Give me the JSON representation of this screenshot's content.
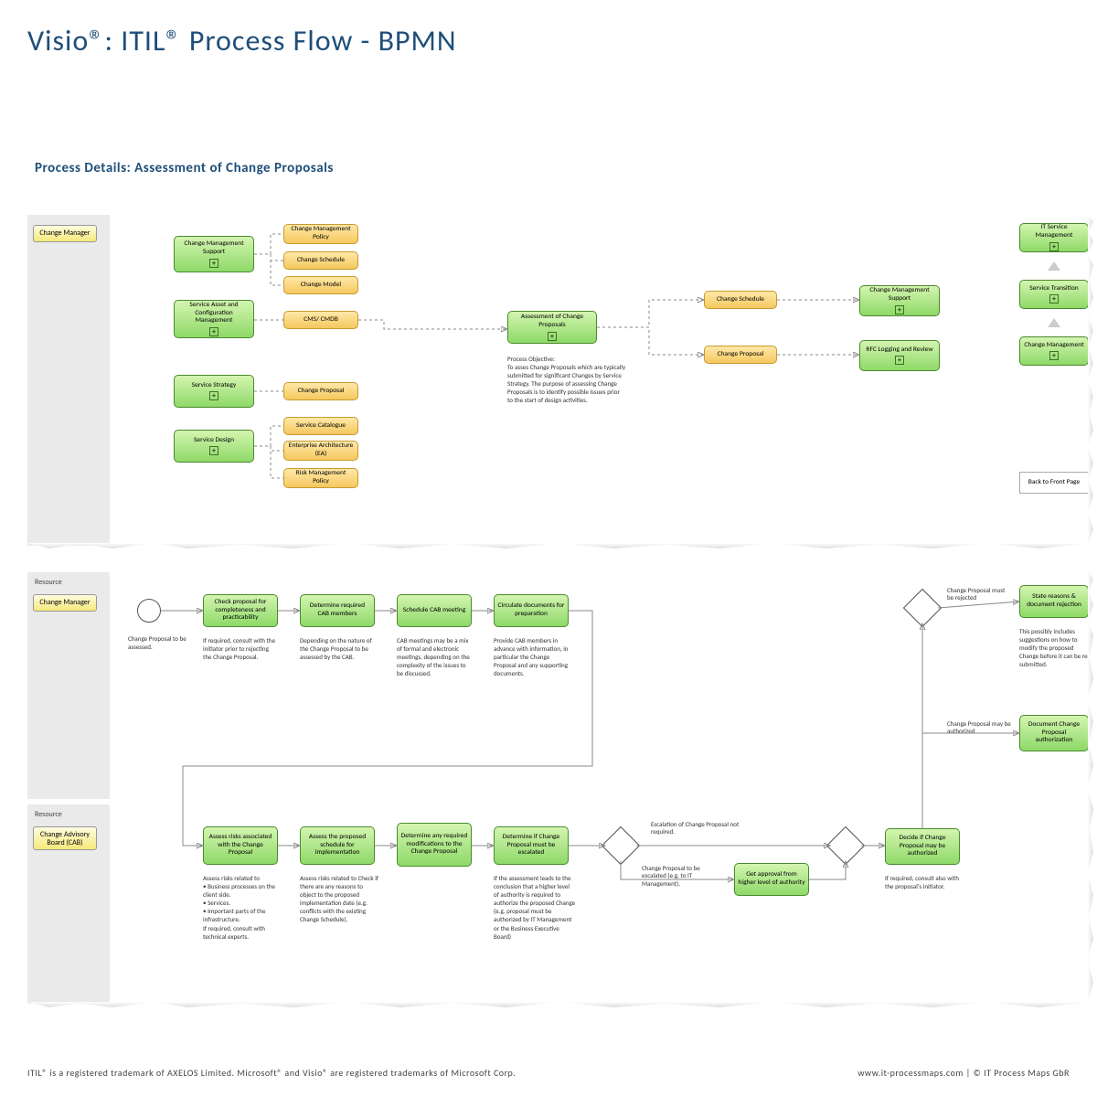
{
  "title": "Visio®: ITIL® Process Flow - BPMN",
  "subtitle": "Process Details: Assessment of Change Proposals",
  "footer_left": "ITIL® is a registered trademark of AXELOS Limited. Microsoft® and Visio® are registered trademarks of Microsoft Corp.",
  "footer_right": "www.it-processmaps.com | © IT Process Maps GbR",
  "lanes": {
    "cm": "Change Manager",
    "cab": "Change Advisory Board (CAB)",
    "resource": "Resource"
  },
  "upper": {
    "green_left": [
      "Change Management Support",
      "Service Asset and Configuration Management",
      "Service Strategy",
      "Service Design"
    ],
    "orange": [
      "Change Management Policy",
      "Change Schedule",
      "Change Model",
      "CMS/ CMDB",
      "Change Proposal",
      "Service Catalogue",
      "Enterprise Architecture (EA)",
      "Risk Management Policy"
    ],
    "center": "Assessment of Change Proposals",
    "center_desc": "Process Objective:\nTo asses Change Proposals which are typically submitted for significant Changes by Service Strategy. The purpose of assessing Change Proposals is to identify possible issues prior to the start of design activities.",
    "right_orange": [
      "Change Schedule",
      "Change Proposal"
    ],
    "right_green": [
      "Change Management Support",
      "RFC Logging and Review"
    ],
    "far_right": [
      "IT Service Management",
      "Service Transition",
      "Change Management"
    ],
    "back_btn": "Back to Front Page"
  },
  "workflow": {
    "start_desc": "Change Proposal to be assessed.",
    "steps": [
      {
        "label": "Check proposal for completeness and practicability",
        "desc": "If required, consult with the initiator prior to rejecting the Change Proposal."
      },
      {
        "label": "Determine required CAB members",
        "desc": "Depending on the nature of the Change Proposal to be assessed by the CAB."
      },
      {
        "label": "Schedule CAB meeting",
        "desc": "CAB meetings may be a mix of formal and electronic meetings, depending on the complexity of the issues to be discussed."
      },
      {
        "label": "Circulate documents for preparation",
        "desc": "Provide CAB members in advance with information, in particular the Change Proposal and any supporting documents."
      }
    ],
    "cab_steps": [
      {
        "label": "Assess risks associated with the Change Proposal",
        "desc": "Assess risks related to\n• Business processes on the client side.\n• Services.\n• Important parts of the infrastructure.\nIf required, consult with technical experts."
      },
      {
        "label": "Assess the proposed schedule for implementation",
        "desc": "Assess risks related to Check if there are any reasons to object to the proposed implementation date (e.g. conflicts with the existing Change Schedule)."
      },
      {
        "label": "Determine any required modifications to the Change Proposal",
        "desc": ""
      },
      {
        "label": "Determine if Change Proposal must be escalated",
        "desc": "If the assessment leads to the conclusion that a higher level of authority is required to authorize the proposed Change (e.g. proposal must be authorized by IT Management or the Business Executive Board)"
      }
    ],
    "gateway_labels": {
      "esc_not_req": "Escalation of Change Proposal not required.",
      "esc_req": "Change Proposal to be escalated (e.g. to IT Management).",
      "reject": "Change Proposal must be rejected",
      "auth": "Change Proposal may be authorized"
    },
    "approval": "Get approval from higher level of authority",
    "decide": "Decide if Change Proposal may be authorized",
    "decide_desc": "If required, consult also with the proposal's initiator.",
    "reject_box": "State reasons & document rejection",
    "reject_desc": "This possibly includes suggestions on how to modify the proposed Change before it can be re-submitted.",
    "auth_box": "Document Change Proposal authorization"
  }
}
